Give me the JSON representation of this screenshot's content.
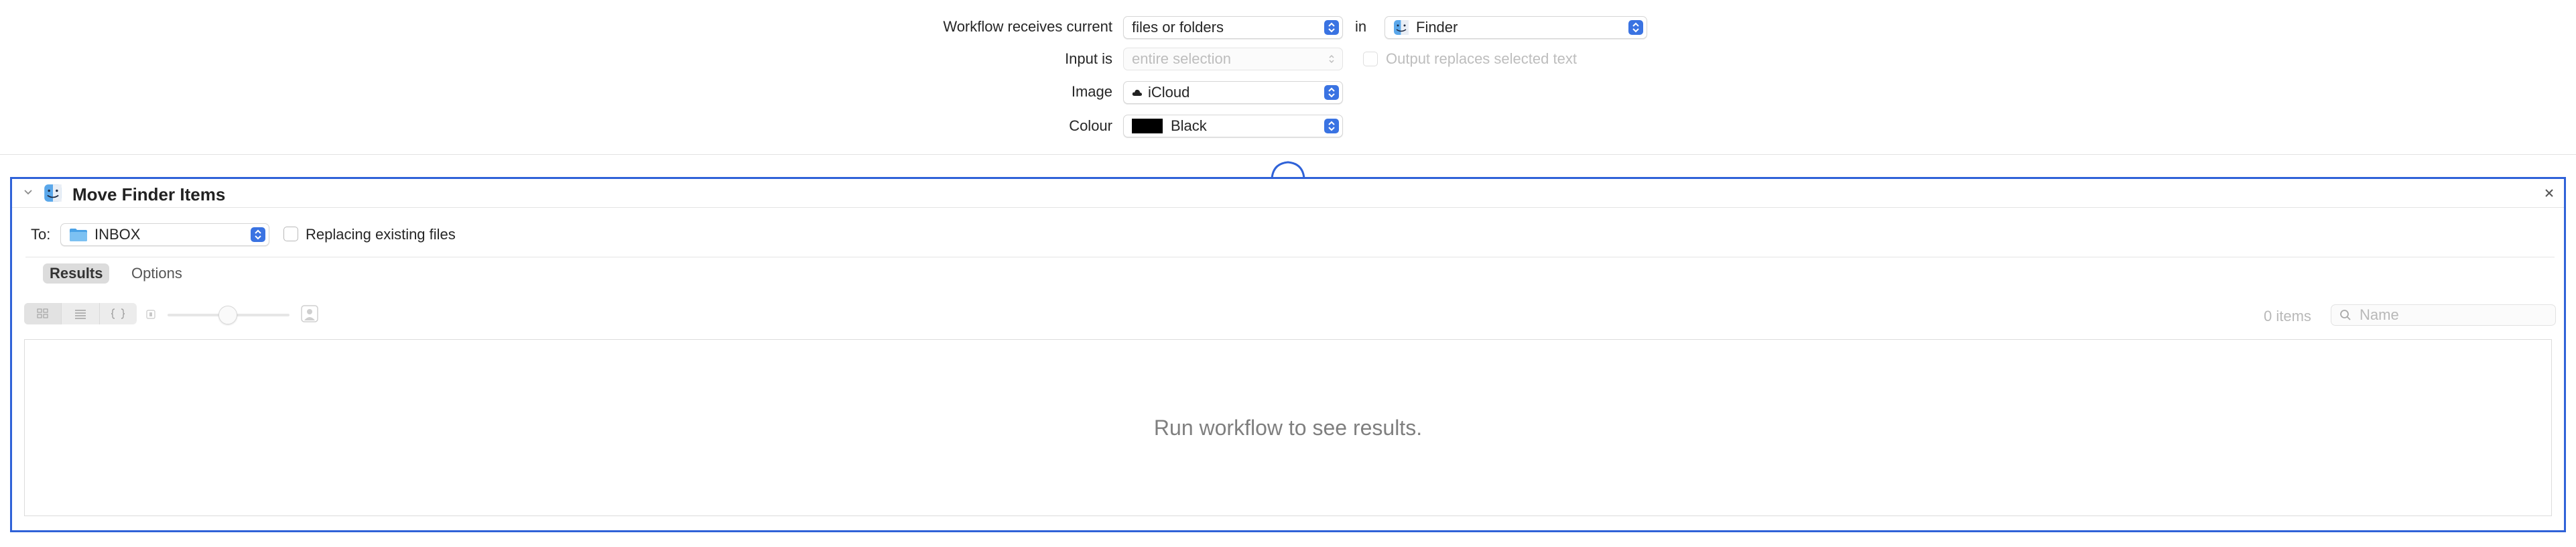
{
  "header": {
    "receives_label": "Workflow receives current",
    "receives_value": "files or folders",
    "in_label": "in",
    "application_value": "Finder",
    "input_is_label": "Input is",
    "input_is_value": "entire selection",
    "output_replaces_label": "Output replaces selected text",
    "image_label": "Image",
    "image_icon": "cloud-icon",
    "image_value": "iCloud",
    "colour_label": "Colour",
    "colour_value": "Black",
    "colour_swatch": "#000000"
  },
  "action": {
    "title": "Move Finder Items",
    "to_label": "To:",
    "to_value": "INBOX",
    "replacing_label": "Replacing existing files",
    "tabs": [
      {
        "label": "Results",
        "active": true
      },
      {
        "label": "Options",
        "active": false
      }
    ],
    "views": [
      "icon-view",
      "list-view",
      "code-view"
    ],
    "slider_min_icon": "small-icon",
    "slider_max_icon": "person-icon",
    "items_count": "0 items",
    "search_placeholder": "Name",
    "empty_message": "Run workflow to see results."
  },
  "colors": {
    "accent": "#2f62d8",
    "stepper": "#3a73e2",
    "folder": "#4aa2e6"
  }
}
